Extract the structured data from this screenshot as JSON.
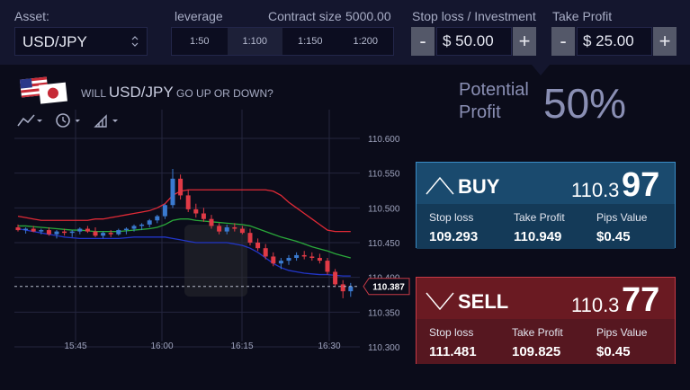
{
  "header": {
    "asset_label": "Asset:",
    "asset_value": "USD/JPY",
    "leverage_label": "leverage",
    "contract_label": "Contract size",
    "contract_value": "5000.00",
    "leverage_options": [
      "1:50",
      "1:100",
      "1:150",
      "1:200"
    ],
    "leverage_selected": "1:100",
    "stop_loss_label": "Stop loss / Investment",
    "stop_loss_value": "$ 50.00",
    "take_profit_label": "Take Profit",
    "take_profit_value": "$ 25.00",
    "minus": "-",
    "plus": "+"
  },
  "question": {
    "pre": "WILL",
    "pair": "USD/JPY",
    "post": "GO UP OR DOWN?"
  },
  "profit": {
    "line1": "Potential",
    "line2": "Profit",
    "value": "50%"
  },
  "buy": {
    "label": "BUY",
    "price_main": "110.3",
    "price_big": "97",
    "stop_loss_label": "Stop loss",
    "stop_loss": "109.293",
    "take_profit_label": "Take Profit",
    "take_profit": "110.949",
    "pips_label": "Pips Value",
    "pips": "$0.45"
  },
  "sell": {
    "label": "SELL",
    "price_main": "110.3",
    "price_big": "77",
    "stop_loss_label": "Stop loss",
    "stop_loss": "111.481",
    "take_profit_label": "Take Profit",
    "take_profit": "109.825",
    "pips_label": "Pips Value",
    "pips": "$0.45"
  },
  "colors": {
    "buy_bg": "#1a4a6e",
    "sell_bg": "#6a1a22",
    "up_candle": "#3a7ad0",
    "down_candle": "#e03a46",
    "upper_band": "#e02a36",
    "mid_band": "#2aa83a",
    "lower_band": "#2236c8"
  },
  "chart_data": {
    "type": "candlestick",
    "x_ticks": [
      "15:45",
      "16:00",
      "16:15",
      "16:30"
    ],
    "y_ticks": [
      "110.600",
      "110.550",
      "110.500",
      "110.450",
      "110.400",
      "110.350",
      "110.300"
    ],
    "ylim": [
      110.3,
      110.6
    ],
    "current_price": "110.387",
    "candles": [
      {
        "o": 110.472,
        "h": 110.476,
        "l": 110.466,
        "c": 110.468
      },
      {
        "o": 110.468,
        "h": 110.472,
        "l": 110.463,
        "c": 110.47
      },
      {
        "o": 110.47,
        "h": 110.474,
        "l": 110.465,
        "c": 110.466
      },
      {
        "o": 110.466,
        "h": 110.47,
        "l": 110.462,
        "c": 110.468
      },
      {
        "o": 110.468,
        "h": 110.472,
        "l": 110.46,
        "c": 110.462
      },
      {
        "o": 110.462,
        "h": 110.468,
        "l": 110.456,
        "c": 110.466
      },
      {
        "o": 110.466,
        "h": 110.47,
        "l": 110.46,
        "c": 110.464
      },
      {
        "o": 110.464,
        "h": 110.468,
        "l": 110.458,
        "c": 110.466
      },
      {
        "o": 110.466,
        "h": 110.472,
        "l": 110.462,
        "c": 110.47
      },
      {
        "o": 110.47,
        "h": 110.474,
        "l": 110.464,
        "c": 110.466
      },
      {
        "o": 110.466,
        "h": 110.472,
        "l": 110.458,
        "c": 110.46
      },
      {
        "o": 110.46,
        "h": 110.466,
        "l": 110.456,
        "c": 110.464
      },
      {
        "o": 110.464,
        "h": 110.468,
        "l": 110.458,
        "c": 110.462
      },
      {
        "o": 110.462,
        "h": 110.47,
        "l": 110.46,
        "c": 110.468
      },
      {
        "o": 110.468,
        "h": 110.472,
        "l": 110.462,
        "c": 110.47
      },
      {
        "o": 110.47,
        "h": 110.476,
        "l": 110.466,
        "c": 110.474
      },
      {
        "o": 110.474,
        "h": 110.478,
        "l": 110.468,
        "c": 110.476
      },
      {
        "o": 110.476,
        "h": 110.484,
        "l": 110.472,
        "c": 110.482
      },
      {
        "o": 110.482,
        "h": 110.49,
        "l": 110.478,
        "c": 110.488
      },
      {
        "o": 110.488,
        "h": 110.506,
        "l": 110.484,
        "c": 110.504
      },
      {
        "o": 110.504,
        "h": 110.556,
        "l": 110.5,
        "c": 110.542
      },
      {
        "o": 110.542,
        "h": 110.548,
        "l": 110.512,
        "c": 110.518
      },
      {
        "o": 110.518,
        "h": 110.526,
        "l": 110.494,
        "c": 110.498
      },
      {
        "o": 110.498,
        "h": 110.506,
        "l": 110.486,
        "c": 110.492
      },
      {
        "o": 110.492,
        "h": 110.5,
        "l": 110.48,
        "c": 110.484
      },
      {
        "o": 110.484,
        "h": 110.49,
        "l": 110.47,
        "c": 110.474
      },
      {
        "o": 110.474,
        "h": 110.478,
        "l": 110.462,
        "c": 110.466
      },
      {
        "o": 110.466,
        "h": 110.476,
        "l": 110.462,
        "c": 110.472
      },
      {
        "o": 110.472,
        "h": 110.478,
        "l": 110.466,
        "c": 110.47
      },
      {
        "o": 110.47,
        "h": 110.474,
        "l": 110.462,
        "c": 110.464
      },
      {
        "o": 110.464,
        "h": 110.47,
        "l": 110.446,
        "c": 110.45
      },
      {
        "o": 110.45,
        "h": 110.456,
        "l": 110.438,
        "c": 110.442
      },
      {
        "o": 110.442,
        "h": 110.448,
        "l": 110.426,
        "c": 110.43
      },
      {
        "o": 110.43,
        "h": 110.436,
        "l": 110.416,
        "c": 110.42
      },
      {
        "o": 110.42,
        "h": 110.428,
        "l": 110.412,
        "c": 110.424
      },
      {
        "o": 110.424,
        "h": 110.432,
        "l": 110.418,
        "c": 110.428
      },
      {
        "o": 110.428,
        "h": 110.436,
        "l": 110.424,
        "c": 110.432
      },
      {
        "o": 110.432,
        "h": 110.438,
        "l": 110.426,
        "c": 110.43
      },
      {
        "o": 110.43,
        "h": 110.436,
        "l": 110.424,
        "c": 110.428
      },
      {
        "o": 110.428,
        "h": 110.434,
        "l": 110.42,
        "c": 110.424
      },
      {
        "o": 110.424,
        "h": 110.428,
        "l": 110.404,
        "c": 110.408
      },
      {
        "o": 110.408,
        "h": 110.412,
        "l": 110.386,
        "c": 110.39
      },
      {
        "o": 110.39,
        "h": 110.396,
        "l": 110.37,
        "c": 110.38
      },
      {
        "o": 110.38,
        "h": 110.392,
        "l": 110.372,
        "c": 110.387
      }
    ],
    "upper_band": [
      110.488,
      110.486,
      110.484,
      110.482,
      110.482,
      110.482,
      110.482,
      110.482,
      110.482,
      110.482,
      110.484,
      110.484,
      110.486,
      110.488,
      110.49,
      110.492,
      110.494,
      110.496,
      110.5,
      110.506,
      110.518,
      110.524,
      110.526,
      110.526,
      110.526,
      110.526,
      110.526,
      110.526,
      110.526,
      110.526,
      110.526,
      110.526,
      110.526,
      110.524,
      110.518,
      110.508,
      110.5,
      110.492,
      110.484,
      110.476,
      110.468,
      110.466,
      110.466,
      110.466
    ],
    "mid_band": [
      110.474,
      110.474,
      110.473,
      110.472,
      110.471,
      110.47,
      110.469,
      110.468,
      110.468,
      110.467,
      110.466,
      110.466,
      110.466,
      110.466,
      110.467,
      110.468,
      110.469,
      110.47,
      110.472,
      110.476,
      110.482,
      110.484,
      110.484,
      110.482,
      110.481,
      110.48,
      110.479,
      110.478,
      110.477,
      110.476,
      110.474,
      110.47,
      110.466,
      110.462,
      110.458,
      110.455,
      110.452,
      110.448,
      110.444,
      110.441,
      110.438,
      110.434,
      110.431,
      110.428
    ],
    "lower_band": [
      110.47,
      110.468,
      110.466,
      110.464,
      110.462,
      110.46,
      110.458,
      110.457,
      110.456,
      110.456,
      110.456,
      110.456,
      110.456,
      110.456,
      110.457,
      110.458,
      110.458,
      110.458,
      110.458,
      110.458,
      110.456,
      110.454,
      110.452,
      110.45,
      110.45,
      110.45,
      110.45,
      110.45,
      110.448,
      110.446,
      110.442,
      110.436,
      110.428,
      110.42,
      110.414,
      110.41,
      110.408,
      110.406,
      110.405,
      110.404,
      110.404,
      110.403,
      110.402,
      110.402
    ]
  }
}
